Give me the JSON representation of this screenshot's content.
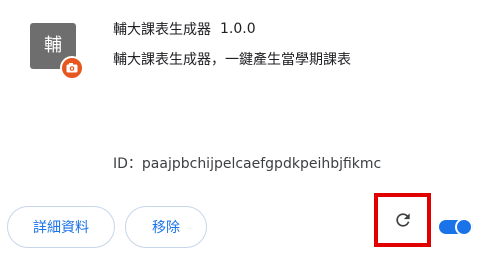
{
  "extension": {
    "icon_text": "輔",
    "badge_icon": "camera-icon",
    "name": "輔大課表生成器",
    "version": "1.0.0",
    "description": "輔大課表生成器，一鍵產生當學期課表",
    "id_text": "ID：paajpbchijpelcaefgpdkpeihbjfikmc"
  },
  "actions": {
    "details_label": "詳細資料",
    "remove_label": "移除",
    "reload_icon": "reload-icon"
  },
  "toggle": {
    "enabled": true
  },
  "colors": {
    "accent": "#1a73e8",
    "highlight_border": "#e00000",
    "badge": "#e8561f",
    "icon_bg": "#6e6e6e"
  }
}
